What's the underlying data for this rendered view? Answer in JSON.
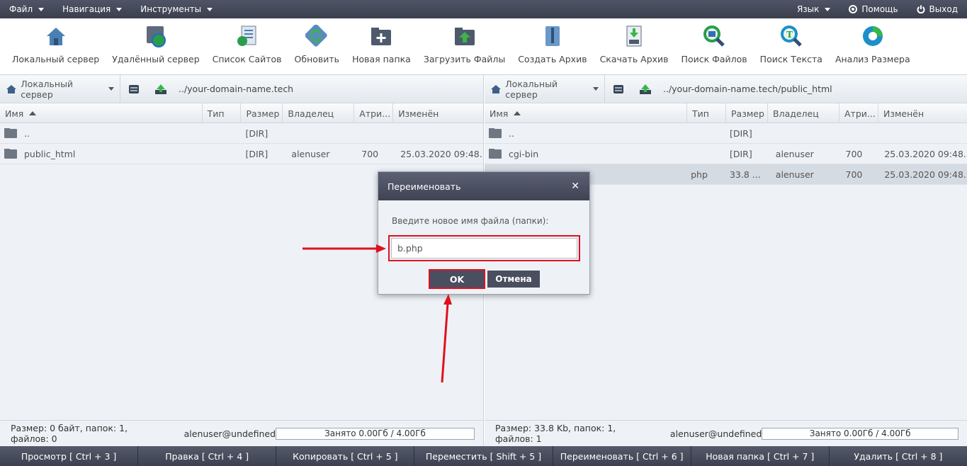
{
  "menu": {
    "file": "Файл",
    "nav": "Навигация",
    "tools": "Инструменты",
    "lang": "Язык",
    "help": "Помощь",
    "exit": "Выход"
  },
  "toolbar": [
    {
      "label": "Локальный сервер",
      "icon": "home-server-icon"
    },
    {
      "label": "Удалённый сервер",
      "icon": "remote-server-icon"
    },
    {
      "label": "Список Сайтов",
      "icon": "sites-list-icon"
    },
    {
      "label": "Обновить",
      "icon": "refresh-icon"
    },
    {
      "label": "Новая папка",
      "icon": "new-folder-icon"
    },
    {
      "label": "Загрузить Файлы",
      "icon": "upload-icon"
    },
    {
      "label": "Создать Архив",
      "icon": "create-archive-icon"
    },
    {
      "label": "Скачать Архив",
      "icon": "download-archive-icon"
    },
    {
      "label": "Поиск Файлов",
      "icon": "search-files-icon"
    },
    {
      "label": "Поиск Текста",
      "icon": "search-text-icon"
    },
    {
      "label": "Анализ Размера",
      "icon": "size-analysis-icon"
    }
  ],
  "left": {
    "server": "Локальный сервер",
    "path": "../your-domain-name.tech",
    "columns": [
      "Имя",
      "Тип",
      "Размер",
      "Владелец",
      "Атри...",
      "Изменён"
    ],
    "rows": [
      {
        "name": "..",
        "type": "",
        "size": "[DIR]",
        "owner": "",
        "attr": "",
        "modified": ""
      },
      {
        "name": "public_html",
        "type": "",
        "size": "[DIR]",
        "owner": "alenuser",
        "attr": "700",
        "modified": "25.03.2020 09:48..."
      }
    ],
    "status": "Размер: 0 байт, папок: 1, файлов: 0",
    "user": "alenuser@undefined",
    "quota": "Занято 0.00Гб / 4.00Гб"
  },
  "right": {
    "server": "Локальный сервер",
    "path": "../your-domain-name.tech/public_html",
    "columns": [
      "Имя",
      "Тип",
      "Размер",
      "Владелец",
      "Атри...",
      "Изменён"
    ],
    "rows": [
      {
        "name": "..",
        "type": "",
        "size": "[DIR]",
        "owner": "",
        "attr": "",
        "modified": ""
      },
      {
        "name": "cgi-bin",
        "type": "",
        "size": "[DIR]",
        "owner": "alenuser",
        "attr": "700",
        "modified": "25.03.2020 09:48..."
      },
      {
        "name": "",
        "type": "php",
        "size": "33.8 ...",
        "owner": "alenuser",
        "attr": "700",
        "modified": "25.03.2020 09:48..."
      }
    ],
    "status": "Размер: 33.8 Kb, папок: 1, файлов: 1",
    "user": "alenuser@undefined",
    "quota": "Занято 0.00Гб / 4.00Гб"
  },
  "dialog": {
    "title": "Переименовать",
    "prompt": "Введите новое имя файла (папки):",
    "value": "b.php",
    "ok": "OK",
    "cancel": "Отмена"
  },
  "bottom": [
    "Просмотр [ Ctrl + 3 ]",
    "Правка [ Ctrl + 4 ]",
    "Копировать [ Ctrl + 5 ]",
    "Переместить [ Shift + 5 ]",
    "Переименовать [ Ctrl + 6 ]",
    "Новая папка [ Ctrl + 7 ]",
    "Удалить [ Ctrl + 8 ]"
  ],
  "colors": {
    "accent": "#e01020",
    "bar": "#3f4354"
  }
}
